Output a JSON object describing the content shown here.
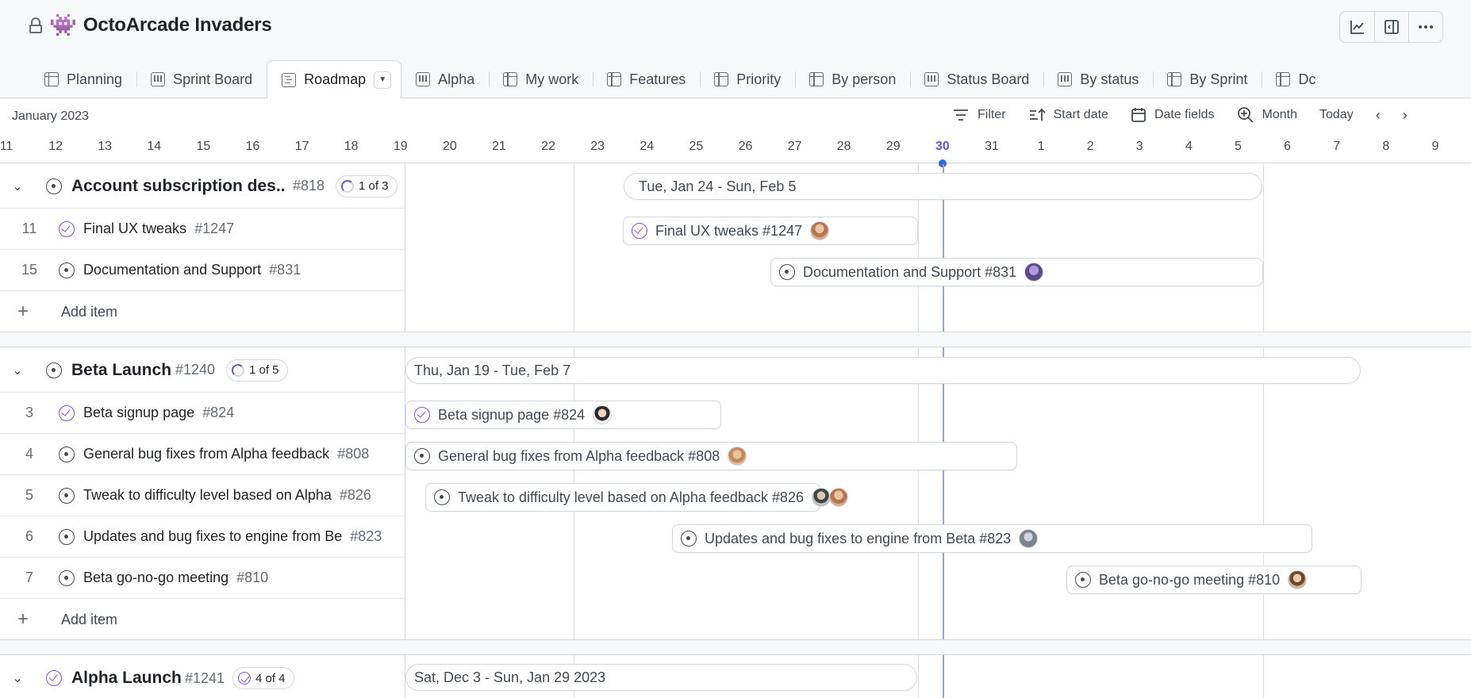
{
  "app": {
    "title": "OctoArcade Invaders",
    "lock_icon": "lock-icon",
    "logo_icon": "invader-icon",
    "actions": [
      "insights-chart-icon",
      "sidebar-panel-icon",
      "more-options-icon"
    ]
  },
  "tabs": [
    {
      "label": "Planning",
      "icon": "table"
    },
    {
      "label": "Sprint Board",
      "icon": "board"
    },
    {
      "label": "Roadmap",
      "icon": "roadmap",
      "active": true
    },
    {
      "label": "Alpha",
      "icon": "board"
    },
    {
      "label": "My work",
      "icon": "table"
    },
    {
      "label": "Features",
      "icon": "table"
    },
    {
      "label": "Priority",
      "icon": "table"
    },
    {
      "label": "By person",
      "icon": "table"
    },
    {
      "label": "Status Board",
      "icon": "board"
    },
    {
      "label": "By status",
      "icon": "board"
    },
    {
      "label": "By Sprint",
      "icon": "table"
    },
    {
      "label": "Dc",
      "icon": "table"
    }
  ],
  "toolbar": {
    "month": "January 2023",
    "filter": "Filter",
    "start_date": "Start date",
    "date_fields": "Date fields",
    "zoom": "Month",
    "today": "Today"
  },
  "days": [
    "11",
    "12",
    "13",
    "14",
    "15",
    "16",
    "17",
    "18",
    "19",
    "20",
    "21",
    "22",
    "23",
    "24",
    "25",
    "26",
    "27",
    "28",
    "29",
    "30",
    "31",
    "1",
    "2",
    "3",
    "4",
    "5",
    "6",
    "7",
    "8",
    "9"
  ],
  "today_day": "30",
  "groups": [
    {
      "title": "Account subscription des...",
      "number": "#818",
      "progress": "1 of 3",
      "status": "open",
      "range": "Tue, Jan 24 - Sun, Feb 5",
      "items": [
        {
          "num": "11",
          "title": "Final UX tweaks",
          "id": "#1247",
          "status": "done",
          "bar": "Final UX tweaks #1247"
        },
        {
          "num": "15",
          "title": "Documentation and Support",
          "id": "#831",
          "status": "open",
          "bar": "Documentation and Support #831"
        }
      ],
      "add_label": "Add item"
    },
    {
      "title": "Beta Launch",
      "number": "#1240",
      "progress": "1 of 5",
      "status": "open",
      "range": "Thu, Jan 19 - Tue, Feb 7",
      "items": [
        {
          "num": "3",
          "title": "Beta signup page",
          "id": "#824",
          "status": "done",
          "bar": "Beta signup page #824"
        },
        {
          "num": "4",
          "title": "General bug fixes from Alpha feedback",
          "id": "#808",
          "status": "open",
          "bar": "General bug fixes from Alpha feedback #808"
        },
        {
          "num": "5",
          "title": "Tweak to difficulty level based on Alpha",
          "id": "#826",
          "status": "open",
          "bar": "Tweak to difficulty level based on Alpha feedback #826"
        },
        {
          "num": "6",
          "title": "Updates and bug fixes to engine from Be",
          "id": "#823",
          "status": "open",
          "bar": "Updates and bug fixes to engine from Beta #823"
        },
        {
          "num": "7",
          "title": "Beta go-no-go meeting",
          "id": "#810",
          "status": "open",
          "bar": "Beta go-no-go meeting #810"
        }
      ],
      "add_label": "Add item"
    },
    {
      "title": "Alpha Launch",
      "number": "#1241",
      "progress": "4 of 4",
      "status": "done",
      "range": "Sat, Dec 3 - Sun, Jan 29 2023"
    }
  ]
}
